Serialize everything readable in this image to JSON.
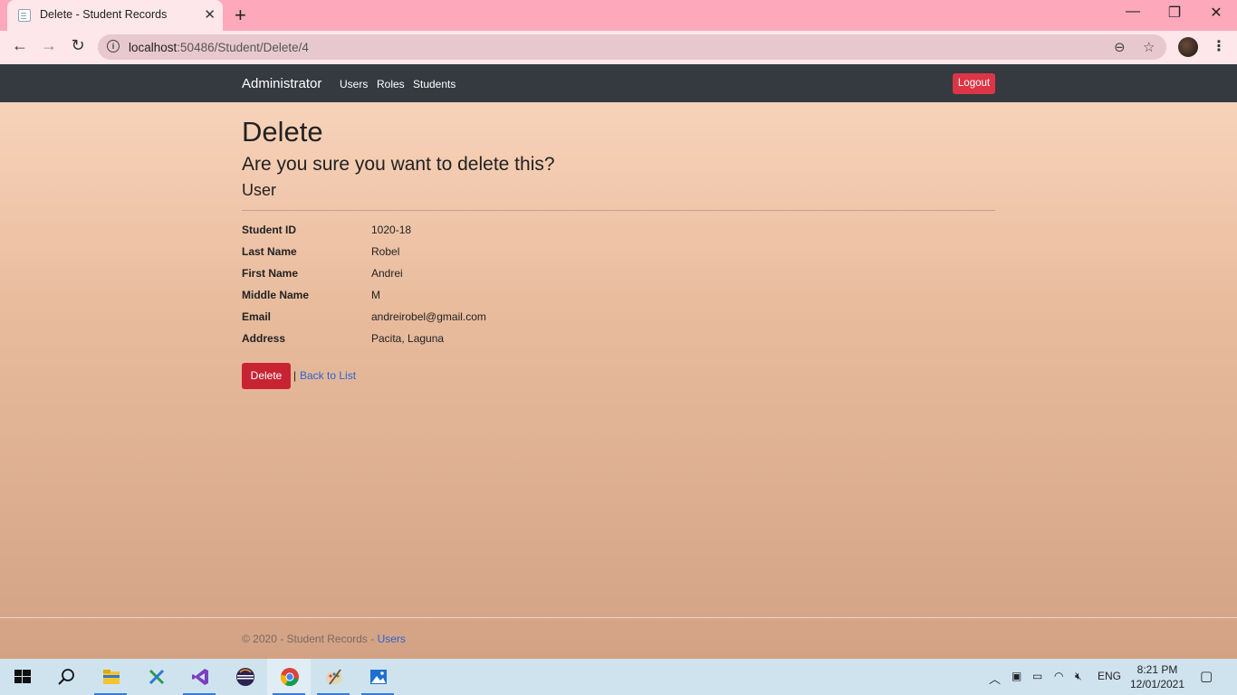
{
  "browser": {
    "tab_title": "Delete - Student Records",
    "url_host": "localhost",
    "url_rest": ":50486/Student/Delete/4"
  },
  "navbar": {
    "brand": "Administrator",
    "links": [
      "Users",
      "Roles",
      "Students"
    ],
    "logout": "Logout"
  },
  "page": {
    "title": "Delete",
    "confirm": "Are you sure you want to delete this?",
    "entity": "User",
    "fields": [
      {
        "label": "Student ID",
        "value": "1020-18"
      },
      {
        "label": "Last Name",
        "value": "Robel"
      },
      {
        "label": "First Name",
        "value": "Andrei"
      },
      {
        "label": "Middle Name",
        "value": "M"
      },
      {
        "label": "Email",
        "value": "andreirobel@gmail.com"
      },
      {
        "label": "Address",
        "value": "Pacita, Laguna"
      }
    ],
    "delete_button": "Delete",
    "separator": "|",
    "back_link": "Back to List"
  },
  "footer": {
    "text": "© 2020 - Student Records - ",
    "link": "Users"
  },
  "taskbar": {
    "language": "ENG",
    "time": "8:21 PM",
    "date": "12/01/2021"
  },
  "colors": {
    "navbar_bg": "#343a40",
    "danger": "#dc3545",
    "link": "#2a64d0"
  }
}
